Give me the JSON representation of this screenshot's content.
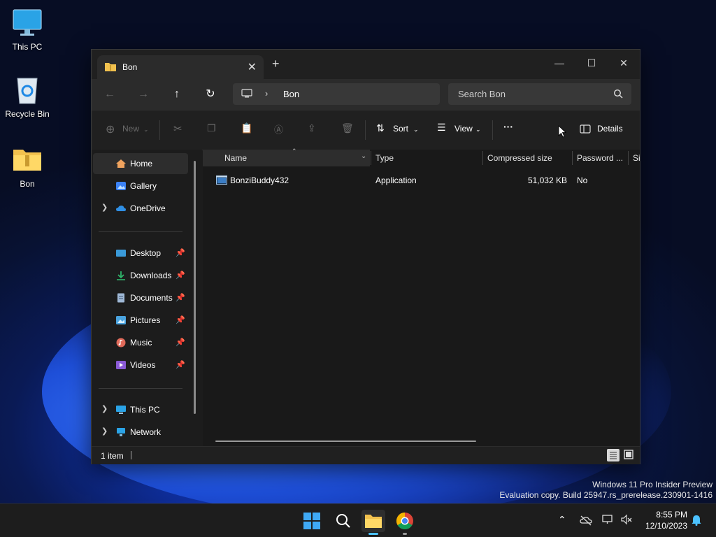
{
  "desktop": {
    "icons": [
      {
        "label": "This PC",
        "icon": "monitor-icon"
      },
      {
        "label": "Recycle Bin",
        "icon": "recycle-bin-icon"
      },
      {
        "label": "Bon",
        "icon": "zip-folder-icon"
      }
    ],
    "watermark": {
      "line1": "Windows 11 Pro Insider Preview",
      "line2": "Evaluation copy. Build 25947.rs_prerelease.230901-1416"
    }
  },
  "window": {
    "tab_title": "Bon",
    "new_tab": "+",
    "address": {
      "crumb": "Bon",
      "separator": "›"
    },
    "search": {
      "placeholder": "Search Bon"
    },
    "toolbar": {
      "new_label": "New",
      "sort_label": "Sort",
      "view_label": "View",
      "more_label": "···",
      "details_label": "Details"
    },
    "nav": {
      "home": "Home",
      "gallery": "Gallery",
      "onedrive": "OneDrive",
      "pinned": [
        {
          "label": "Desktop",
          "color": "#3a9ad9"
        },
        {
          "label": "Downloads",
          "color": "#2fb36a"
        },
        {
          "label": "Documents",
          "color": "#9fb8d6"
        },
        {
          "label": "Pictures",
          "color": "#4aa3df"
        },
        {
          "label": "Music",
          "color": "#e06a5a"
        },
        {
          "label": "Videos",
          "color": "#8a5ad6"
        }
      ],
      "this_pc": "This PC",
      "network": "Network"
    },
    "columns": {
      "name": "Name",
      "type": "Type",
      "compressed": "Compressed size",
      "password": "Password ...",
      "size": "Si"
    },
    "files": [
      {
        "name": "BonziBuddy432",
        "type": "Application",
        "compressed": "51,032 KB",
        "password": "No"
      }
    ],
    "status": {
      "count": "1 item"
    }
  },
  "taskbar": {
    "time": "8:55 PM",
    "date": "12/10/2023"
  },
  "colors": {
    "accent": "#0078d4",
    "window_bg": "#1c1c1c",
    "taskbar_bg": "#1d1d1d"
  }
}
